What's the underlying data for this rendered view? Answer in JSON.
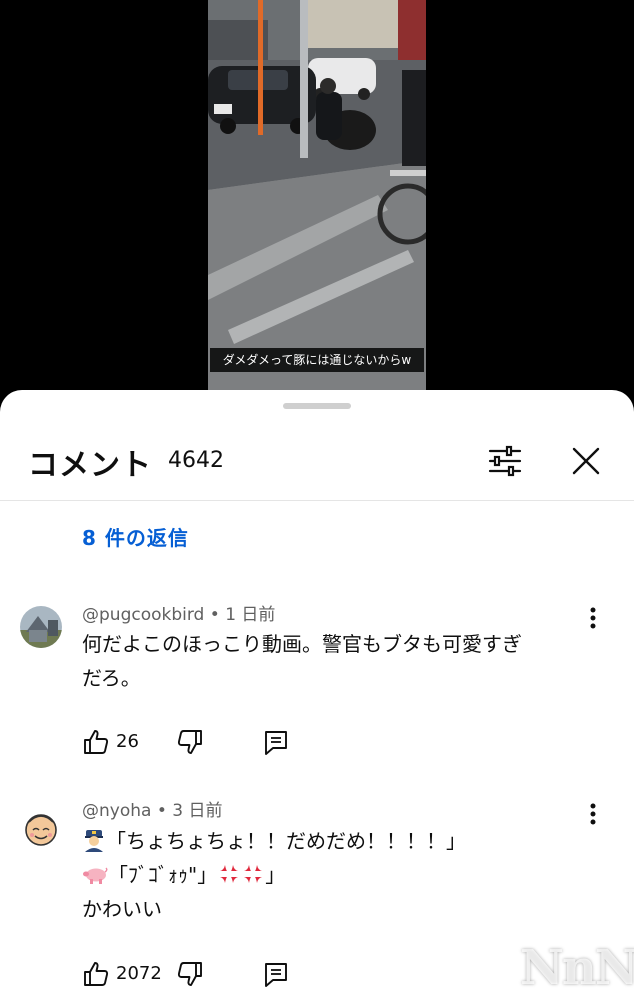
{
  "video": {
    "caption": "ダメダメって豚には通じないからw"
  },
  "header": {
    "title": "コメント",
    "count": "4642"
  },
  "replies_link": "8 件の返信",
  "comments": [
    {
      "author": "@pugcookbird",
      "time": "1 日前",
      "lines": [
        "何だよこのほっこり動画。警官もブタも可愛すぎ",
        "だろ。"
      ],
      "likes": "26"
    },
    {
      "author": "@nyoha",
      "time": "3 日前",
      "lines": [
        "「ちょちょちょ！！だめだめ！！！！」",
        "「ﾌﾞｺﾞｫｩ\"」",
        "かわいい"
      ],
      "likes": "2072"
    }
  ],
  "icons": {
    "filter": "sliders-icon",
    "close": "close-icon",
    "more": "more-vert-icon",
    "like": "thumbs-up-icon",
    "dislike": "thumbs-down-icon",
    "reply": "reply-icon",
    "police": "police-emoji",
    "pig": "pig-emoji",
    "anger": "anger-emoji"
  },
  "watermark": "NnN",
  "colors": {
    "link": "#065fd4",
    "text": "#0f0f0f",
    "meta": "#606060",
    "anger": "#e0283c"
  }
}
